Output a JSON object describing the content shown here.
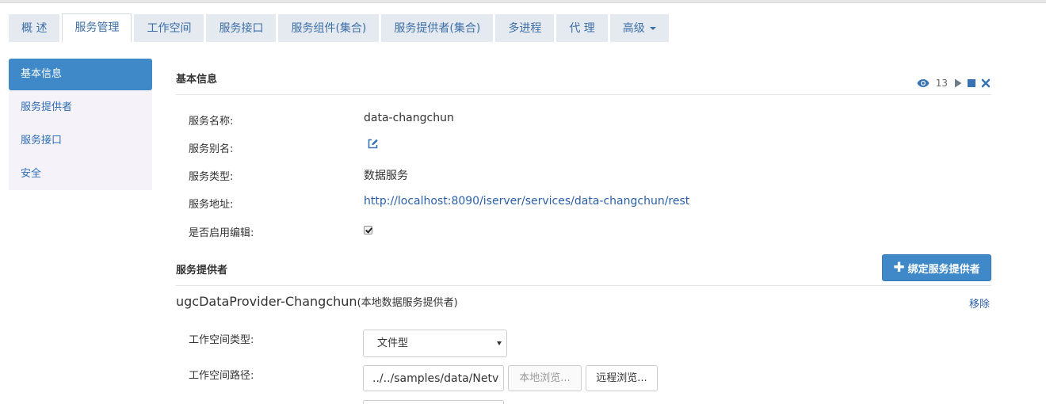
{
  "tabs": [
    {
      "label": "概 述",
      "active": false
    },
    {
      "label": "服务管理",
      "active": true
    },
    {
      "label": "工作空间",
      "active": false
    },
    {
      "label": "服务接口",
      "active": false
    },
    {
      "label": "服务组件(集合)",
      "active": false
    },
    {
      "label": "服务提供者(集合)",
      "active": false
    },
    {
      "label": "多进程",
      "active": false
    },
    {
      "label": "代 理",
      "active": false
    },
    {
      "label": "高级",
      "active": false,
      "dropdown": true
    }
  ],
  "sidebar": {
    "items": [
      {
        "label": "基本信息",
        "active": true
      },
      {
        "label": "服务提供者",
        "active": false
      },
      {
        "label": "服务接口",
        "active": false
      },
      {
        "label": "安全",
        "active": false
      }
    ]
  },
  "basic": {
    "title": "基本信息",
    "view_count": "13",
    "icons": [
      "eye-icon",
      "play-icon",
      "stop-icon",
      "close-icon"
    ],
    "name_label": "服务名称:",
    "name_value": "data-changchun",
    "alias_label": "服务别名:",
    "type_label": "服务类型:",
    "type_value": "数据服务",
    "address_label": "服务地址:",
    "address_value": "http://localhost:8090/iserver/services/data-changchun/rest",
    "edit_label": "是否启用编辑:",
    "edit_enabled": true
  },
  "providers": {
    "title": "服务提供者",
    "bind_button": "绑定服务提供者",
    "provider_name": "ugcDataProvider-Changchun",
    "provider_sub": "(本地数据服务提供者)",
    "remove_label": "移除",
    "workspace_type_label": "工作空间类型:",
    "workspace_type_value": "文件型",
    "workspace_path_label": "工作空间路径:",
    "workspace_path_value": "../../samples/data/Netv",
    "local_browse": "本地浏览...",
    "remote_browse": "远程浏览..."
  },
  "colors": {
    "accent": "#3f89c9",
    "link": "#2a5fa8",
    "tab_bg": "#e5e9f0",
    "sidebar_bg": "#f5f3f9"
  }
}
